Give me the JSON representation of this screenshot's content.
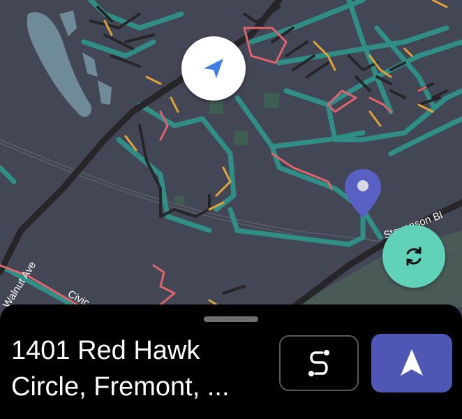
{
  "map": {
    "street_labels": [
      "Walnut Ave",
      "Civic",
      "Stevenson Bl"
    ],
    "colors": {
      "background": "#434654",
      "road_casing": "#2f8f86",
      "road": "#262629",
      "traffic_orange": "#e0a33a",
      "traffic_red": "#e0646c",
      "water": "#6f8a99",
      "park": "#4a5a56"
    }
  },
  "controls": {
    "recenter_icon": "location-arrow-icon",
    "refresh_icon": "refresh-icon",
    "destination_pin_icon": "map-pin-icon"
  },
  "bottom_sheet": {
    "address_line1": "1401 Red Hawk",
    "address_line2": "Circle, Fremont, ...",
    "route_icon": "route-icon",
    "navigate_icon": "navigation-arrow-icon",
    "navigate_color": "#4e57b3",
    "refresh_color": "#5fd2b8"
  }
}
